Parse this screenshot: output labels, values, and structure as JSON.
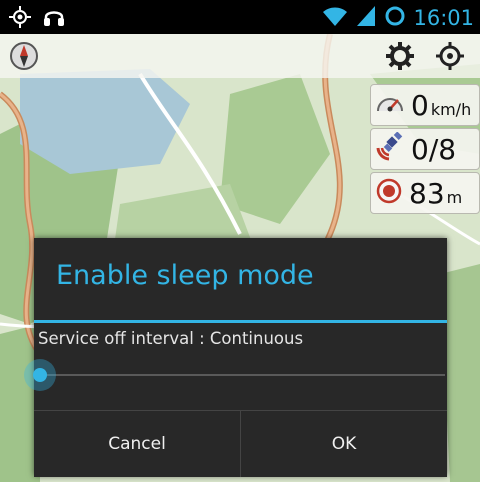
{
  "statusbar": {
    "time": "16:01",
    "icons": [
      "gps-icon",
      "headphones-icon",
      "wifi-icon",
      "signal-icon",
      "sync-icon"
    ]
  },
  "map_toolbar": {
    "icons": [
      "compass-icon",
      "settings-gear-icon",
      "locate-target-icon"
    ]
  },
  "widgets": {
    "speed": {
      "value": "0",
      "unit": "km/h",
      "icon": "speedometer-icon"
    },
    "satellites": {
      "value": "0/8",
      "icon": "satellite-icon"
    },
    "accuracy": {
      "value": "83",
      "unit": "m",
      "icon": "record-target-icon"
    }
  },
  "dialog": {
    "title": "Enable sleep mode",
    "label": "Service off interval : Continuous",
    "slider_position": 0,
    "cancel_label": "Cancel",
    "ok_label": "OK"
  },
  "colors": {
    "accent": "#33b5e5",
    "dialog_bg": "#282828",
    "statusbar_bg": "#000000"
  }
}
